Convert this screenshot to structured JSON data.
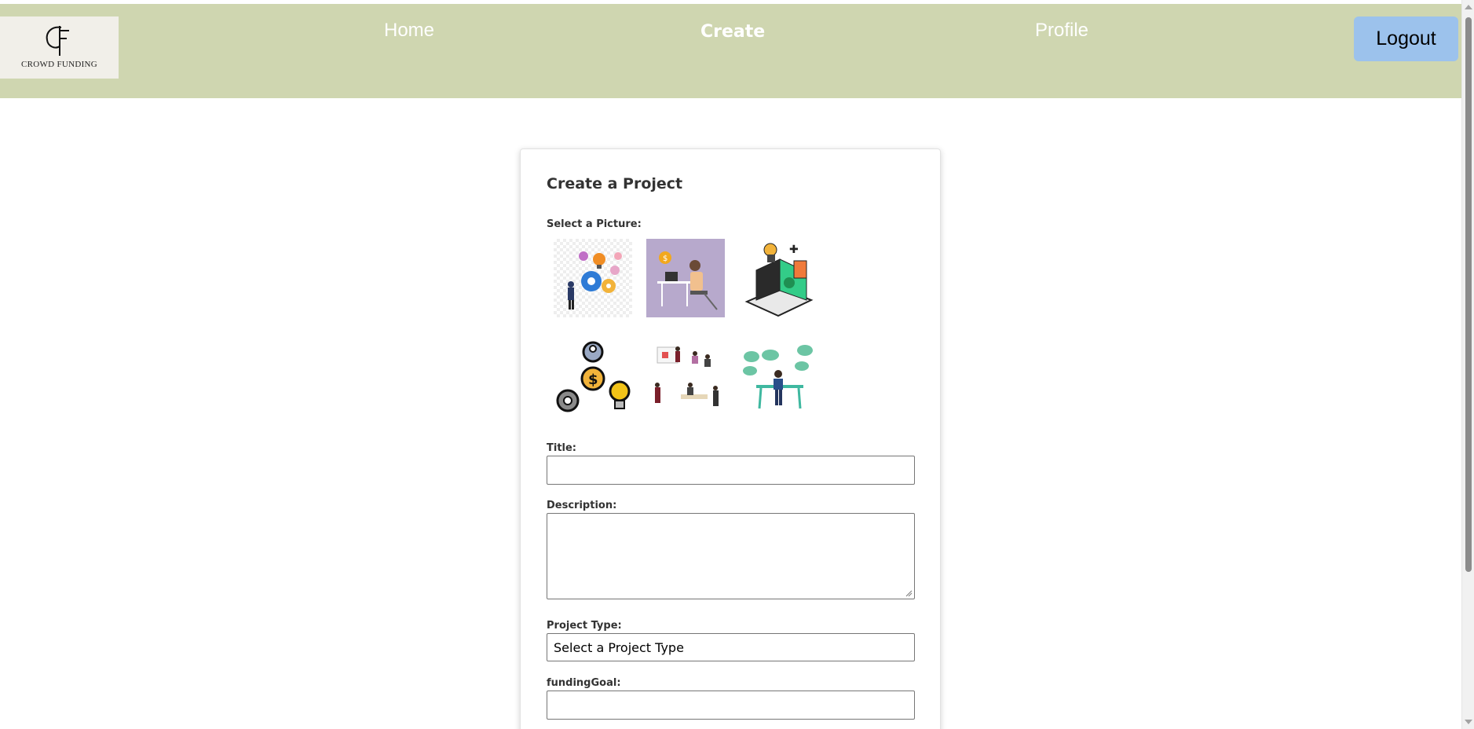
{
  "brand": {
    "logo_letters": "CF",
    "logo_text": "CROWD FUNDING"
  },
  "nav": {
    "home": "Home",
    "create": "Create",
    "profile": "Profile",
    "logout": "Logout"
  },
  "form": {
    "title": "Create a Project",
    "select_picture_label": "Select a Picture:",
    "pictures": [
      "teamwork-gears-bulb-illustration",
      "freelancer-laptop-illustration",
      "isometric-laptop-crowdfunding-illustration",
      "funding-gears-bulb-icon",
      "office-meeting-people-illustration",
      "person-desk-thought-clouds-illustration"
    ],
    "title_label": "Title:",
    "title_value": "",
    "description_label": "Description:",
    "description_value": "",
    "project_type_label": "Project Type:",
    "project_type_selected": "Select a Project Type",
    "funding_goal_label": "fundingGoal:",
    "funding_goal_value": ""
  },
  "colors": {
    "navbar_bg": "#cfd6b0",
    "logout_bg": "#9cc2ec"
  }
}
